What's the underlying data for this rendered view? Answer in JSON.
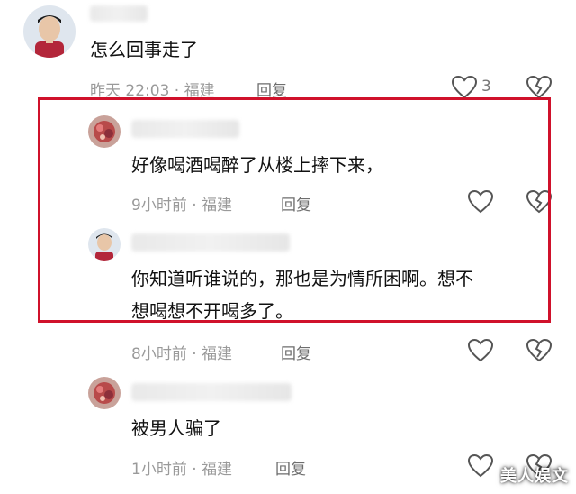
{
  "comments": [
    {
      "text": "怎么回事走了",
      "meta": "昨天 22:03 · 福建",
      "reply_label": "回复",
      "like_count": "3"
    },
    {
      "text": "好像喝酒喝醉了从楼上摔下来，",
      "meta": "9小时前 · 福建",
      "reply_label": "回复"
    },
    {
      "text_line1": "你知道听谁说的，那也是为情所困啊。想不",
      "text_line2": "想喝想不开喝多了。",
      "meta": "8小时前 · 福建",
      "reply_label": "回复"
    },
    {
      "text": "被男人骗了",
      "meta": "1小时前 · 福建",
      "reply_label": "回复"
    }
  ],
  "watermark": "美人娱文",
  "colors": {
    "highlight_border": "#d0112b",
    "meta_text": "#9a9a9a",
    "icon_stroke": "#555555"
  }
}
